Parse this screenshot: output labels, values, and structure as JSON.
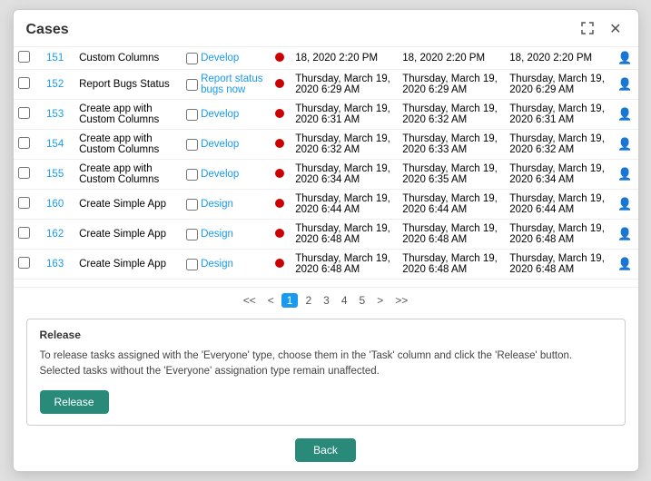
{
  "modal": {
    "title": "Cases",
    "expand_label": "expand",
    "close_label": "close"
  },
  "table": {
    "rows": [
      {
        "id": "151",
        "description": "Custom Columns",
        "task_checkbox": false,
        "task_label": "Develop",
        "date1": "18, 2020 2:20 PM",
        "date2": "18, 2020 2:20 PM",
        "date3": "18, 2020 2:20 PM"
      },
      {
        "id": "152",
        "description": "Report Bugs Status",
        "task_checkbox": false,
        "task_label": "Report status bugs now",
        "date1": "Thursday, March 19, 2020 6:29 AM",
        "date2": "Thursday, March 19, 2020 6:29 AM",
        "date3": "Thursday, March 19, 2020 6:29 AM"
      },
      {
        "id": "153",
        "description": "Create app with Custom Columns",
        "task_checkbox": false,
        "task_label": "Develop",
        "date1": "Thursday, March 19, 2020 6:31 AM",
        "date2": "Thursday, March 19, 2020 6:32 AM",
        "date3": "Thursday, March 19, 2020 6:31 AM"
      },
      {
        "id": "154",
        "description": "Create app with Custom Columns",
        "task_checkbox": false,
        "task_label": "Develop",
        "date1": "Thursday, March 19, 2020 6:32 AM",
        "date2": "Thursday, March 19, 2020 6:33 AM",
        "date3": "Thursday, March 19, 2020 6:32 AM"
      },
      {
        "id": "155",
        "description": "Create app with Custom Columns",
        "task_checkbox": false,
        "task_label": "Develop",
        "date1": "Thursday, March 19, 2020 6:34 AM",
        "date2": "Thursday, March 19, 2020 6:35 AM",
        "date3": "Thursday, March 19, 2020 6:34 AM"
      },
      {
        "id": "160",
        "description": "Create Simple App",
        "task_checkbox": false,
        "task_label": "Design",
        "date1": "Thursday, March 19, 2020 6:44 AM",
        "date2": "Thursday, March 19, 2020 6:44 AM",
        "date3": "Thursday, March 19, 2020 6:44 AM"
      },
      {
        "id": "162",
        "description": "Create Simple App",
        "task_checkbox": false,
        "task_label": "Design",
        "date1": "Thursday, March 19, 2020 6:48 AM",
        "date2": "Thursday, March 19, 2020 6:48 AM",
        "date3": "Thursday, March 19, 2020 6:48 AM"
      },
      {
        "id": "163",
        "description": "Create Simple App",
        "task_checkbox": false,
        "task_label": "Design",
        "date1": "Thursday, March 19, 2020 6:48 AM",
        "date2": "Thursday, March 19, 2020 6:48 AM",
        "date3": "Thursday, March 19, 2020 6:48 AM"
      }
    ]
  },
  "pagination": {
    "first": "<<",
    "prev": "<",
    "current": "1",
    "pages": [
      "1",
      "2",
      "3",
      "4",
      "5"
    ],
    "next": ">",
    "last": ">>"
  },
  "release_section": {
    "title": "Release",
    "text": "To release tasks assigned with the 'Everyone' type, choose them in the 'Task' column and click the 'Release' button. Selected tasks without the 'Everyone' assignation type remain unaffected.",
    "button_label": "Release"
  },
  "footer": {
    "back_label": "Back"
  }
}
